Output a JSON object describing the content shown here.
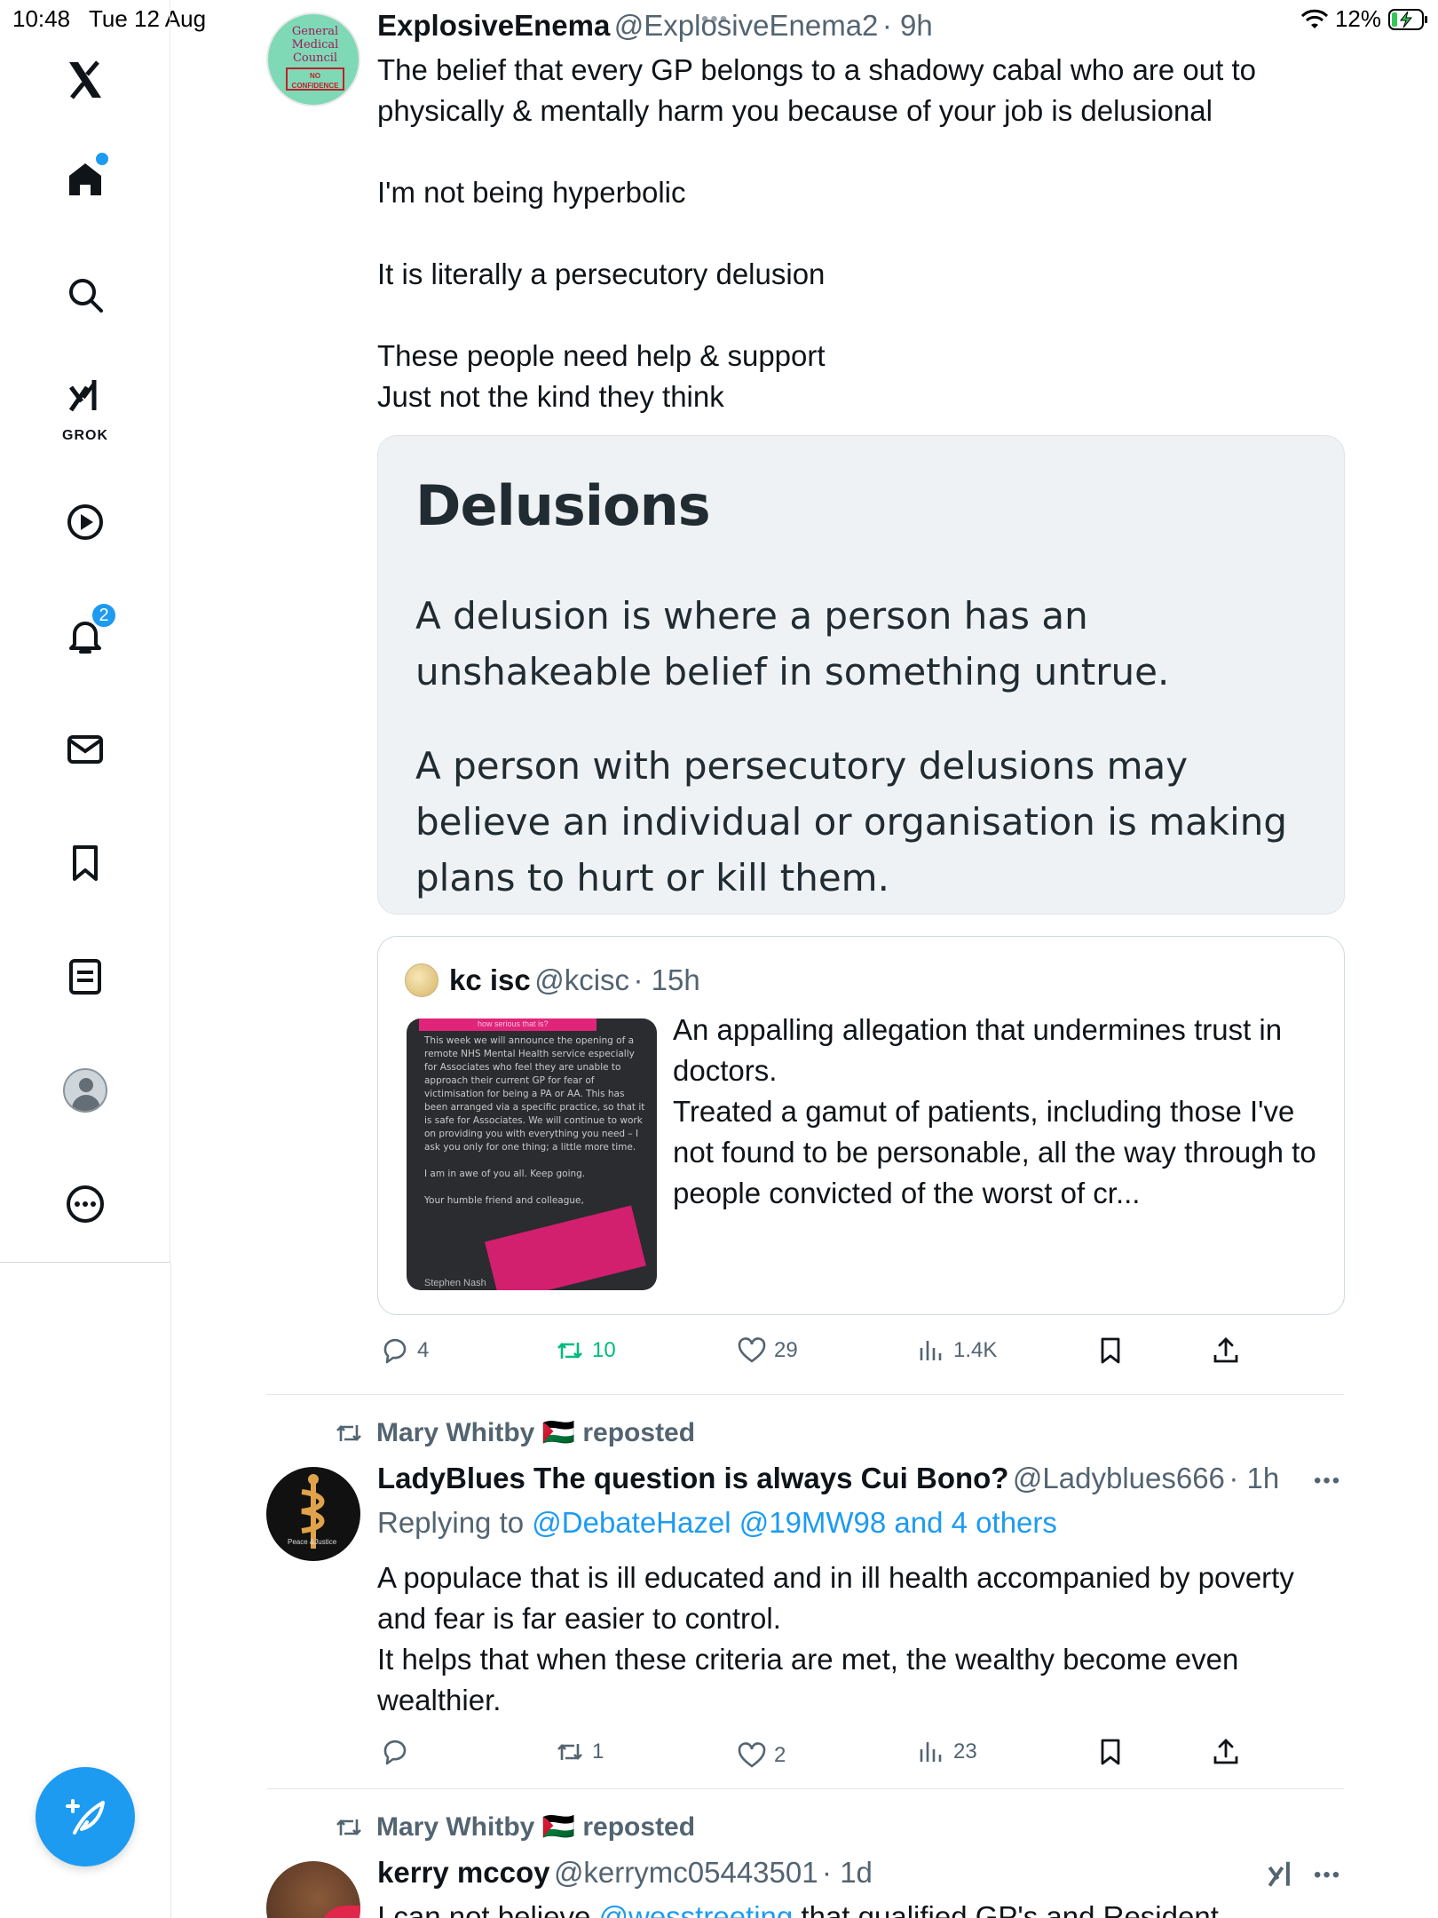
{
  "status_bar": {
    "time": "10:48",
    "date": "Tue 12 Aug",
    "battery": "12%"
  },
  "sidebar": {
    "grok_label": "GROK",
    "notifications_count": "2"
  },
  "tweet1": {
    "name": "ExplosiveEnema",
    "handle": "@ExplosiveEnema2",
    "time": "· 9h",
    "avatar_text": "General Medical Council",
    "avatar_stamp": "NO CONFIDENCE",
    "text": "The belief that every GP belongs to a shadowy cabal who are out to\nphysically & mentally harm you because of your job is delusional\n\nI'm not being hyperbolic\n\nIt is literally a persecutory delusion\n\nThese people need help & support\nJust not the kind they think",
    "card": {
      "title": "Delusions",
      "para1": "A delusion is where a person has an unshakeable belief in something untrue.",
      "para2": "A person with persecutory delusions may believe an individual or organisation is making plans to hurt or kill them."
    },
    "quote": {
      "name": "kc isc",
      "handle": "@kcisc",
      "time": "· 15h",
      "text": "An appalling allegation that undermines trust in doctors.\nTreated a gamut of patients, including those I've not found to be personable, all the way through to people convicted of the worst of cr...",
      "thumb_header": "how serious that is?",
      "thumb_text": "This week we will announce the opening of a remote NHS Mental Health service especially for Associates who feel they are unable to approach their current GP for fear of victimisation for being a PA or AA. This has been arranged via a specific practice, so that it is safe for Associates. We will continue to work on providing you with everything you need – I ask you only for one thing; a little more time.\n\nI am in awe of you all. Keep going.\n\nYour humble friend and colleague,",
      "thumb_sign": "Stephen Nash"
    },
    "actions": {
      "replies": "4",
      "reposts": "10",
      "likes": "29",
      "views": "1.4K"
    }
  },
  "tweet2": {
    "repost_by": "Mary Whitby 🇵🇸 reposted",
    "name": "LadyBlues The question is always Cui Bono?",
    "handle": "@Ladyblues666",
    "time": "· 1h",
    "avatar_text": "Peace &Justice",
    "replying_prefix": "Replying to ",
    "replying_to": "@DebateHazel @19MW98 and 4 others",
    "text": "A populace that is ill educated and in ill health accompanied by poverty\nand fear is far easier to control.\nIt helps that when these criteria are met, the wealthy become even\nwealthier.",
    "actions": {
      "replies": "",
      "reposts": "1",
      "likes": "2",
      "views": "23"
    }
  },
  "tweet3": {
    "repost_by": "Mary Whitby 🇵🇸 reposted",
    "name": "kerry mccoy",
    "handle": "@kerrymc05443501",
    "time": "· 1d",
    "text_prefix": "I can not believe ",
    "text_link": "@wesstreeting",
    "text_suffix": " that qualified GP's and Resident"
  },
  "colors": {
    "accent": "#1d9bf0",
    "repost_green": "#00ba7c",
    "muted": "#536471"
  }
}
